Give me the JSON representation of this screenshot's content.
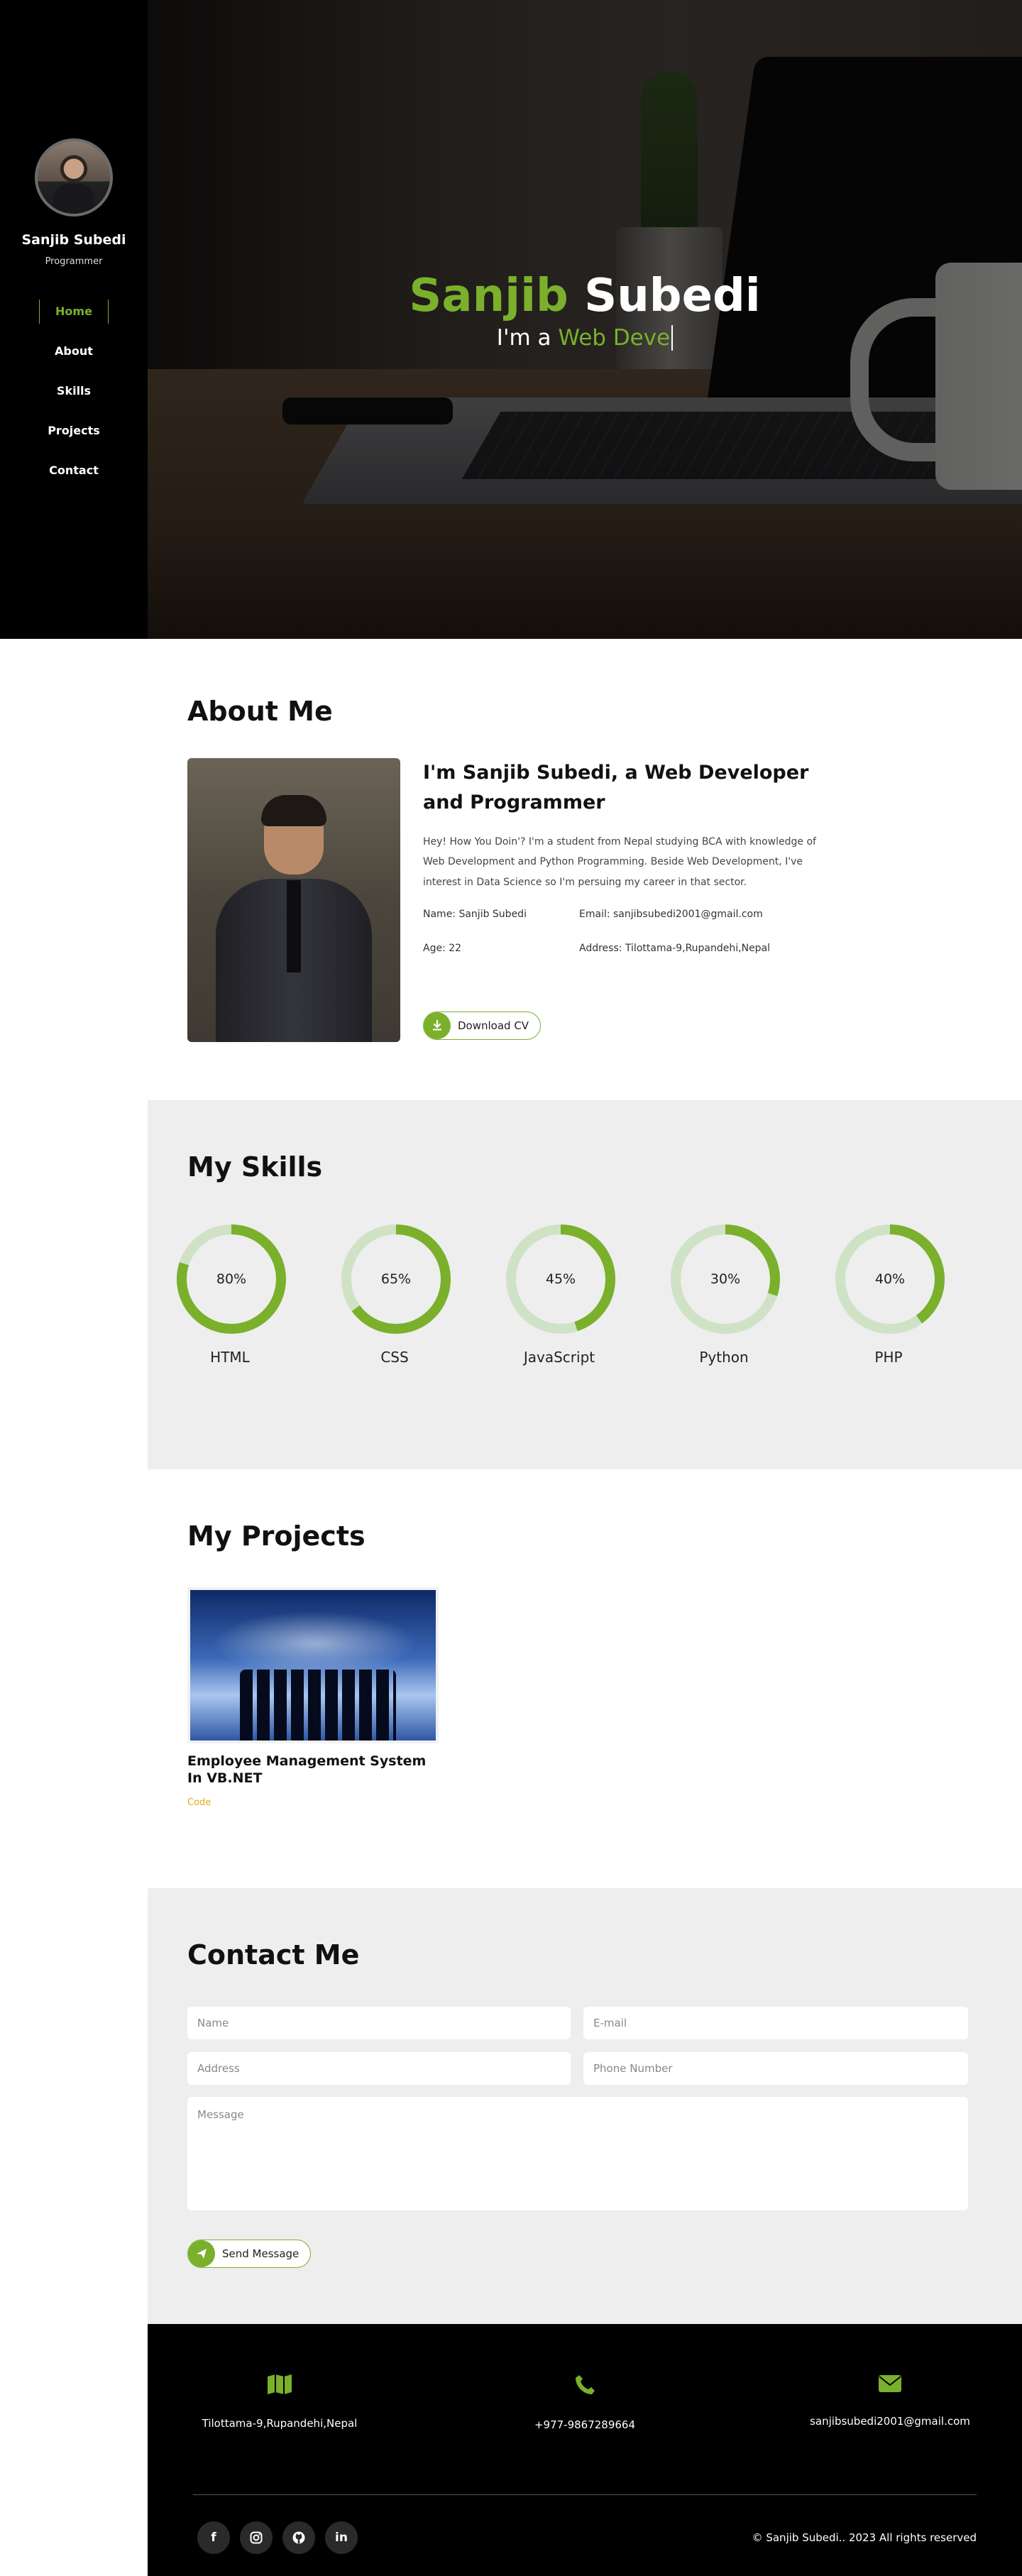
{
  "sidebar": {
    "name": "Sanjib Subedi",
    "role": "Programmer",
    "nav": [
      {
        "label": "Home",
        "active": true
      },
      {
        "label": "About",
        "active": false
      },
      {
        "label": "Skills",
        "active": false
      },
      {
        "label": "Projects",
        "active": false
      },
      {
        "label": "Contact",
        "active": false
      }
    ]
  },
  "hero": {
    "first_name": "Sanjib",
    "last_name": "Subedi",
    "prefix": "I'm a",
    "typed": "Web Deve"
  },
  "about": {
    "title": "About Me",
    "heading": "I'm Sanjib Subedi, a Web Developer and Programmer",
    "description": "Hey! How You Doin'? I'm a student from Nepal studying BCA with knowledge of Web Development and Python Programming. Beside Web Development, I've interest in Data Science so I'm persuing my career in that sector.",
    "name_line": "Name: Sanjib Subedi",
    "email_line": "Email: sanjibsubedi2001@gmail.com",
    "age_line": "Age: 22",
    "address_line": "Address: Tilottama-9,Rupandehi,Nepal",
    "download_label": "Download CV"
  },
  "skills": {
    "title": "My Skills",
    "items": [
      {
        "name": "HTML",
        "percent": 80,
        "label": "80%"
      },
      {
        "name": "CSS",
        "percent": 65,
        "label": "65%"
      },
      {
        "name": "JavaScript",
        "percent": 45,
        "label": "45%"
      },
      {
        "name": "Python",
        "percent": 30,
        "label": "30%"
      },
      {
        "name": "PHP",
        "percent": 40,
        "label": "40%"
      }
    ]
  },
  "projects": {
    "title": "My Projects",
    "items": [
      {
        "title": "Employee Management System In VB.NET",
        "link": "Code"
      }
    ]
  },
  "contact": {
    "title": "Contact Me",
    "name_placeholder": "Name",
    "email_placeholder": "E-mail",
    "address_placeholder": "Address",
    "phone_placeholder": "Phone Number",
    "message_placeholder": "Message",
    "send_label": "Send Message"
  },
  "footer": {
    "address": "Tilottama-9,Rupandehi,Nepal",
    "phone": "+977-9867289664",
    "email": "sanjibsubedi2001@gmail.com",
    "copyright": "© Sanjib Subedi.. 2023 All rights reserved",
    "socials": [
      "facebook-icon",
      "instagram-icon",
      "github-icon",
      "linkedin-icon"
    ],
    "icons": [
      "map-icon",
      "phone-icon",
      "envelope-icon"
    ]
  },
  "colors": {
    "accent": "#7ab02c",
    "link": "#e6a81a",
    "sidebar_bg": "#000000",
    "section_gray": "#eeeeee",
    "ring_track": "#cfe2c6"
  }
}
